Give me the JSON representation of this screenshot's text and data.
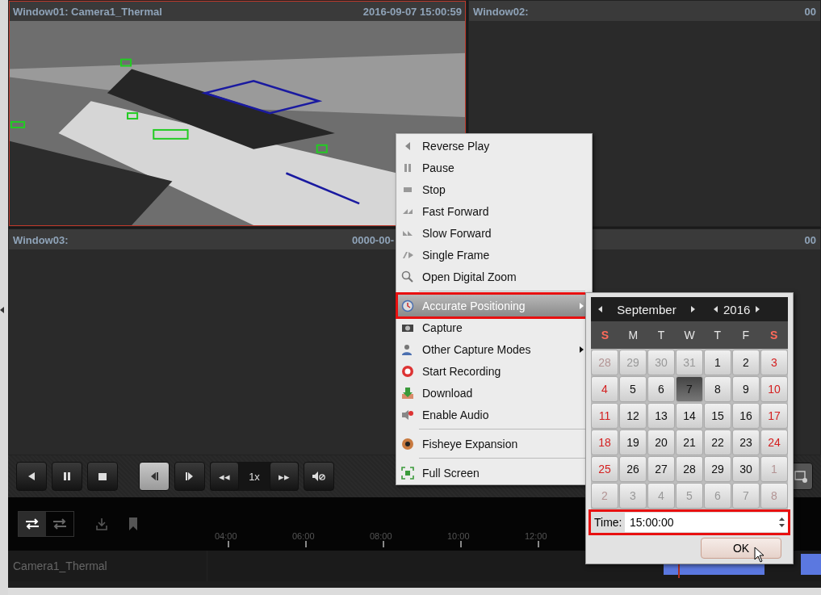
{
  "windows": [
    {
      "title": "Window01: Camera1_Thermal",
      "time": "2016-09-07 15:00:59",
      "selected": true,
      "has_video": true
    },
    {
      "title": "Window02:",
      "time": "00",
      "selected": false,
      "has_video": false
    },
    {
      "title": "Window03:",
      "time": "0000-00-",
      "selected": false,
      "has_video": false
    },
    {
      "time": "00",
      "selected": false,
      "has_video": false
    }
  ],
  "playback_controls": [
    {
      "kind": "reverse-play",
      "selected": false
    },
    {
      "kind": "pause",
      "selected": false
    },
    {
      "kind": "stop",
      "selected": false
    },
    {
      "kind": "frame-back",
      "selected": true
    },
    {
      "kind": "frame-forward",
      "selected": false
    }
  ],
  "speed": {
    "slower": "◂◂",
    "value": "1x",
    "faster": "▸▸"
  },
  "view_toggles": [
    {
      "selected": true
    },
    {
      "selected": false
    }
  ],
  "timeline": {
    "ticks": [
      "04:00",
      "06:00",
      "08:00",
      "10:00",
      "12:00"
    ],
    "track_label": "Camera1_Thermal"
  },
  "context_menu": {
    "groups": [
      [
        {
          "label": "Reverse Play",
          "submenu": false,
          "selected": false,
          "annotated": false
        },
        {
          "label": "Pause",
          "submenu": false,
          "selected": false,
          "annotated": false
        },
        {
          "label": "Stop",
          "submenu": false,
          "selected": false,
          "annotated": false
        },
        {
          "label": "Fast Forward",
          "submenu": false,
          "selected": false,
          "annotated": false
        },
        {
          "label": "Slow Forward",
          "submenu": false,
          "selected": false,
          "annotated": false
        },
        {
          "label": "Single Frame",
          "submenu": false,
          "selected": false,
          "annotated": false
        },
        {
          "label": "Open Digital Zoom",
          "submenu": false,
          "selected": false,
          "annotated": false
        }
      ],
      [
        {
          "label": "Accurate Positioning",
          "submenu": true,
          "selected": true,
          "annotated": true
        },
        {
          "label": "Capture",
          "submenu": false,
          "selected": false,
          "annotated": false
        },
        {
          "label": "Other Capture Modes",
          "submenu": true,
          "selected": false,
          "annotated": false
        },
        {
          "label": "Start Recording",
          "submenu": false,
          "selected": false,
          "annotated": false
        },
        {
          "label": "Download",
          "submenu": false,
          "selected": false,
          "annotated": false
        },
        {
          "label": "Enable Audio",
          "submenu": false,
          "selected": false,
          "annotated": false
        }
      ],
      [
        {
          "label": "Fisheye Expansion",
          "submenu": false,
          "selected": false,
          "annotated": false
        }
      ],
      [
        {
          "label": "Full Screen",
          "submenu": false,
          "selected": false,
          "annotated": false
        }
      ]
    ]
  },
  "calendar": {
    "month": "September",
    "year": "2016",
    "weekdays": [
      {
        "label": "S",
        "weekend": true
      },
      {
        "label": "M",
        "weekend": false
      },
      {
        "label": "T",
        "weekend": false
      },
      {
        "label": "W",
        "weekend": false
      },
      {
        "label": "T",
        "weekend": false
      },
      {
        "label": "F",
        "weekend": false
      },
      {
        "label": "S",
        "weekend": true
      }
    ],
    "weeks": [
      [
        {
          "day": "28",
          "other_month": true,
          "weekend": true,
          "selected": false
        },
        {
          "day": "29",
          "other_month": true,
          "weekend": false,
          "selected": false
        },
        {
          "day": "30",
          "other_month": true,
          "weekend": false,
          "selected": false
        },
        {
          "day": "31",
          "other_month": true,
          "weekend": false,
          "selected": false
        },
        {
          "day": "1",
          "other_month": false,
          "weekend": false,
          "selected": false
        },
        {
          "day": "2",
          "other_month": false,
          "weekend": false,
          "selected": false
        },
        {
          "day": "3",
          "other_month": false,
          "weekend": true,
          "selected": false
        }
      ],
      [
        {
          "day": "4",
          "other_month": false,
          "weekend": true,
          "selected": false
        },
        {
          "day": "5",
          "other_month": false,
          "weekend": false,
          "selected": false
        },
        {
          "day": "6",
          "other_month": false,
          "weekend": false,
          "selected": false
        },
        {
          "day": "7",
          "other_month": false,
          "weekend": false,
          "selected": true
        },
        {
          "day": "8",
          "other_month": false,
          "weekend": false,
          "selected": false
        },
        {
          "day": "9",
          "other_month": false,
          "weekend": false,
          "selected": false
        },
        {
          "day": "10",
          "other_month": false,
          "weekend": true,
          "selected": false
        }
      ],
      [
        {
          "day": "11",
          "other_month": false,
          "weekend": true,
          "selected": false
        },
        {
          "day": "12",
          "other_month": false,
          "weekend": false,
          "selected": false
        },
        {
          "day": "13",
          "other_month": false,
          "weekend": false,
          "selected": false
        },
        {
          "day": "14",
          "other_month": false,
          "weekend": false,
          "selected": false
        },
        {
          "day": "15",
          "other_month": false,
          "weekend": false,
          "selected": false
        },
        {
          "day": "16",
          "other_month": false,
          "weekend": false,
          "selected": false
        },
        {
          "day": "17",
          "other_month": false,
          "weekend": true,
          "selected": false
        }
      ],
      [
        {
          "day": "18",
          "other_month": false,
          "weekend": true,
          "selected": false
        },
        {
          "day": "19",
          "other_month": false,
          "weekend": false,
          "selected": false
        },
        {
          "day": "20",
          "other_month": false,
          "weekend": false,
          "selected": false
        },
        {
          "day": "21",
          "other_month": false,
          "weekend": false,
          "selected": false
        },
        {
          "day": "22",
          "other_month": false,
          "weekend": false,
          "selected": false
        },
        {
          "day": "23",
          "other_month": false,
          "weekend": false,
          "selected": false
        },
        {
          "day": "24",
          "other_month": false,
          "weekend": true,
          "selected": false
        }
      ],
      [
        {
          "day": "25",
          "other_month": false,
          "weekend": true,
          "selected": false
        },
        {
          "day": "26",
          "other_month": false,
          "weekend": false,
          "selected": false
        },
        {
          "day": "27",
          "other_month": false,
          "weekend": false,
          "selected": false
        },
        {
          "day": "28",
          "other_month": false,
          "weekend": false,
          "selected": false
        },
        {
          "day": "29",
          "other_month": false,
          "weekend": false,
          "selected": false
        },
        {
          "day": "30",
          "other_month": false,
          "weekend": false,
          "selected": false
        },
        {
          "day": "1",
          "other_month": true,
          "weekend": true,
          "selected": false
        }
      ],
      [
        {
          "day": "2",
          "other_month": true,
          "weekend": true,
          "selected": false
        },
        {
          "day": "3",
          "other_month": true,
          "weekend": false,
          "selected": false
        },
        {
          "day": "4",
          "other_month": true,
          "weekend": false,
          "selected": false
        },
        {
          "day": "5",
          "other_month": true,
          "weekend": false,
          "selected": false
        },
        {
          "day": "6",
          "other_month": true,
          "weekend": false,
          "selected": false
        },
        {
          "day": "7",
          "other_month": true,
          "weekend": false,
          "selected": false
        },
        {
          "day": "8",
          "other_month": true,
          "weekend": true,
          "selected": false
        }
      ]
    ],
    "time_label": "Time:",
    "time_value": "15:00:00",
    "time_annotated": true,
    "ok": "OK"
  }
}
